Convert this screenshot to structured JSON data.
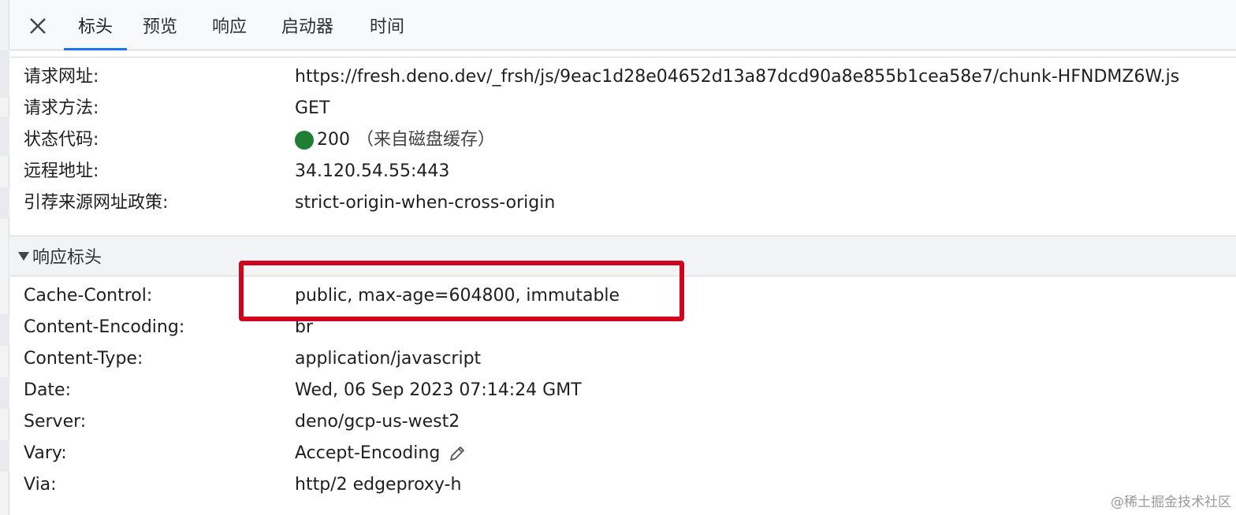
{
  "tabs": {
    "close_icon": "close-icon",
    "items": [
      {
        "label": "标头",
        "active": true
      },
      {
        "label": "预览",
        "active": false
      },
      {
        "label": "响应",
        "active": false
      },
      {
        "label": "启动器",
        "active": false
      },
      {
        "label": "时间",
        "active": false
      }
    ]
  },
  "general": {
    "request_url": {
      "key": "请求网址:",
      "value": "https://fresh.deno.dev/_frsh/js/9eac1d28e04652d13a87dcd90a8e855b1cea58e7/chunk-HFNDMZ6W.js"
    },
    "request_method": {
      "key": "请求方法:",
      "value": "GET"
    },
    "status_code": {
      "key": "状态代码:",
      "value": "200",
      "note": "（来自磁盘缓存）",
      "color": "#1e7e34"
    },
    "remote_address": {
      "key": "远程地址:",
      "value": "34.120.54.55:443"
    },
    "referrer_policy": {
      "key": "引荐来源网址政策:",
      "value": "strict-origin-when-cross-origin"
    }
  },
  "response_headers": {
    "title": "响应标头",
    "items": [
      {
        "key": "Cache-Control:",
        "value": "public, max-age=604800, immutable"
      },
      {
        "key": "Content-Encoding:",
        "value": "br"
      },
      {
        "key": "Content-Type:",
        "value": "application/javascript"
      },
      {
        "key": "Date:",
        "value": "Wed, 06 Sep 2023 07:14:24 GMT"
      },
      {
        "key": "Server:",
        "value": "deno/gcp-us-west2"
      },
      {
        "key": "Vary:",
        "value": "Accept-Encoding"
      },
      {
        "key": "Via:",
        "value": "http/2 edgeproxy-h"
      }
    ]
  },
  "highlight_color": "#d0021b",
  "accent_color": "#1a73e8",
  "watermark": "@稀土掘金技术社区"
}
